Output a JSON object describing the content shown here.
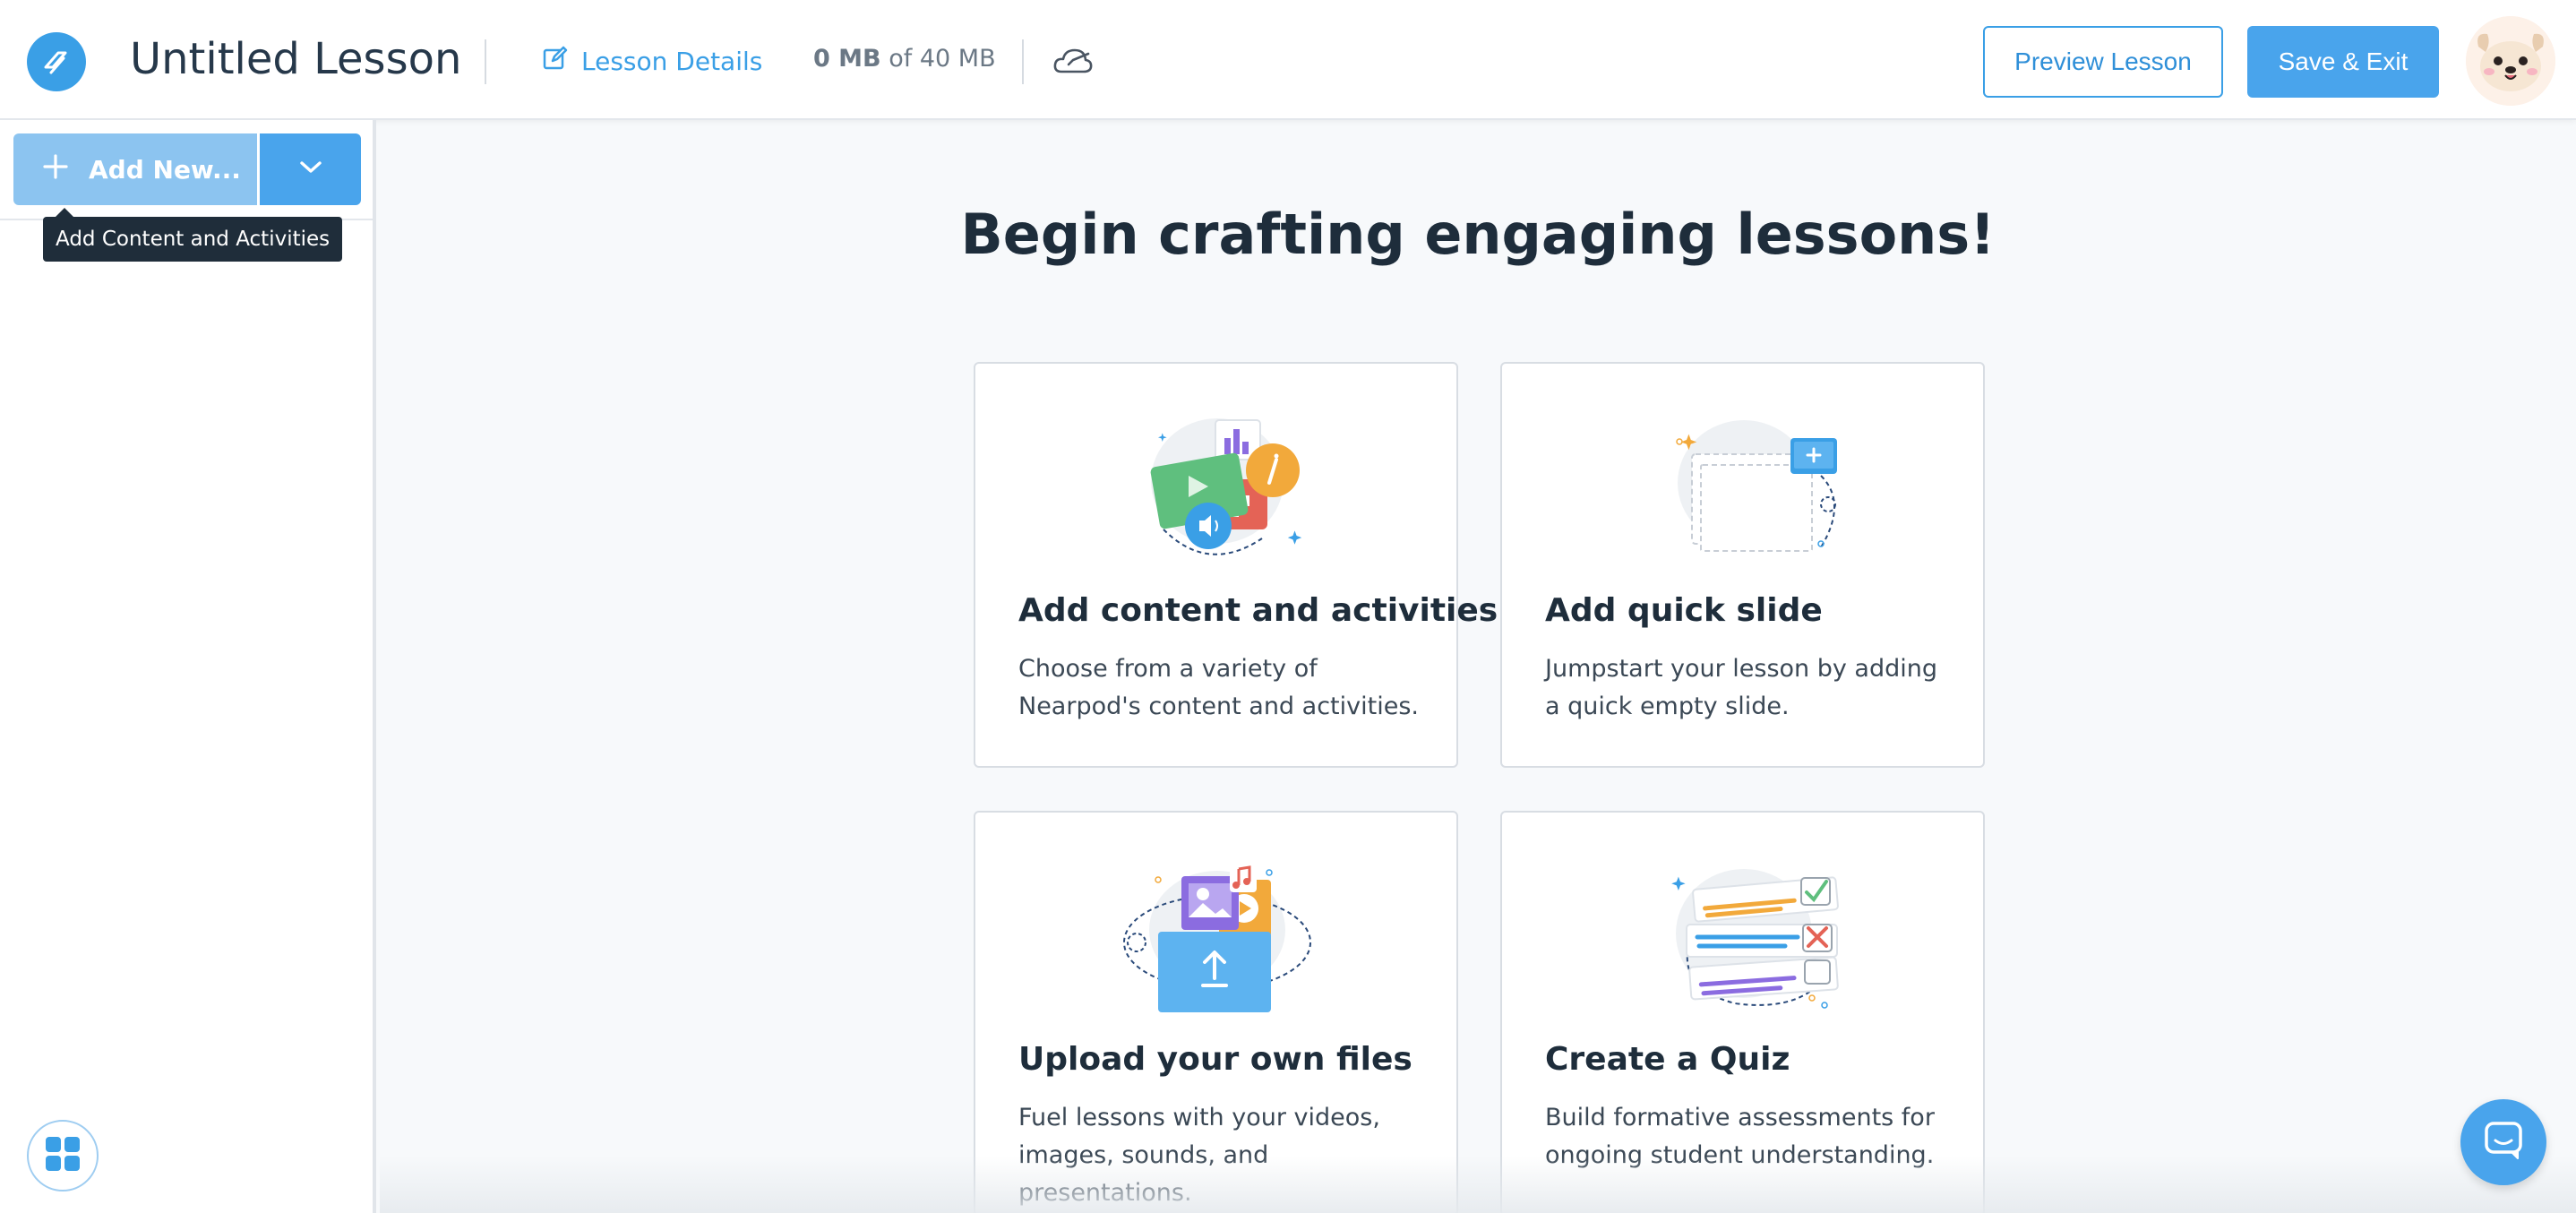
{
  "header": {
    "lesson_title": "Untitled Lesson",
    "details_label": "Lesson Details",
    "storage_used": "0 MB",
    "storage_rest": " of 40 MB",
    "preview_label": "Preview Lesson",
    "save_label": "Save & Exit"
  },
  "sidebar": {
    "add_new_label": "Add New...",
    "tooltip": "Add Content and Activities"
  },
  "main": {
    "heading": "Begin crafting engaging lessons!",
    "cards": [
      {
        "title": "Add content and activities",
        "desc": "Choose from a variety of Nearpod's content and activities."
      },
      {
        "title": "Add quick slide",
        "desc": "Jumpstart your lesson by adding a quick empty slide."
      },
      {
        "title": "Upload your own files",
        "desc": "Fuel lessons with your videos, images, sounds, and presentations."
      },
      {
        "title": "Create a Quiz",
        "desc": "Build formative assessments for ongoing student understanding."
      }
    ]
  },
  "colors": {
    "accent": "#49a4ec",
    "accent_dark": "#2f8fd8",
    "tooltip_bg": "#1f2d3a"
  },
  "icons": [
    "nearpod-logo-icon",
    "edit-icon",
    "cloud-icon",
    "plus-icon",
    "chevron-down-icon",
    "apps-grid-icon",
    "chat-icon"
  ]
}
